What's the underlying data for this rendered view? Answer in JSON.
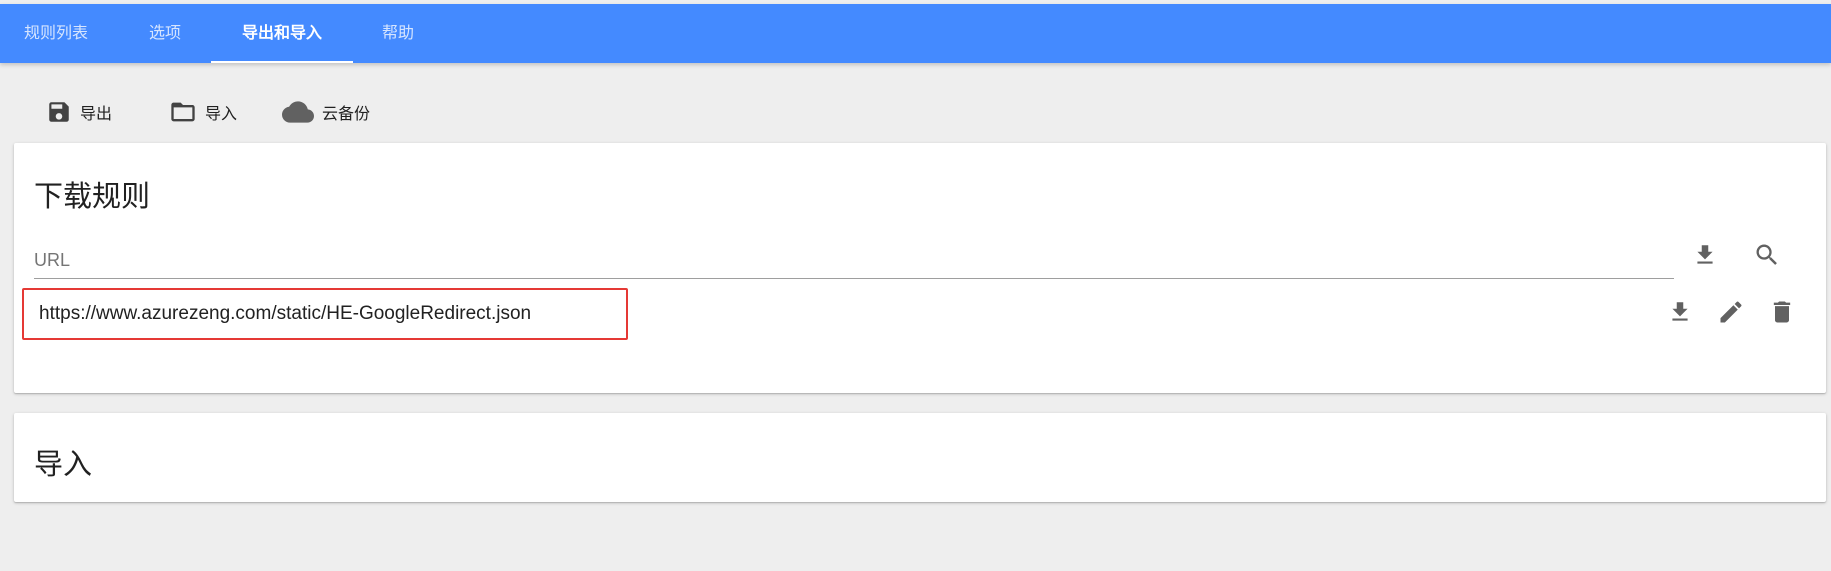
{
  "tabs": [
    {
      "label": "规则列表",
      "active": false
    },
    {
      "label": "选项",
      "active": false
    },
    {
      "label": "导出和导入",
      "active": true
    },
    {
      "label": "帮助",
      "active": false
    }
  ],
  "toolbar": {
    "export_label": "导出",
    "import_label": "导入",
    "cloud_backup_label": "云备份"
  },
  "download_card": {
    "title": "下载规则",
    "url_placeholder": "URL",
    "url_value": "",
    "rules": [
      {
        "url": "https://www.azurezeng.com/static/HE-GoogleRedirect.json"
      }
    ]
  },
  "import_card": {
    "title": "导入"
  },
  "colors": {
    "app_bar": "#448aff",
    "background": "#eeeeee",
    "icon": "#616161",
    "highlight_border": "#e53935"
  }
}
